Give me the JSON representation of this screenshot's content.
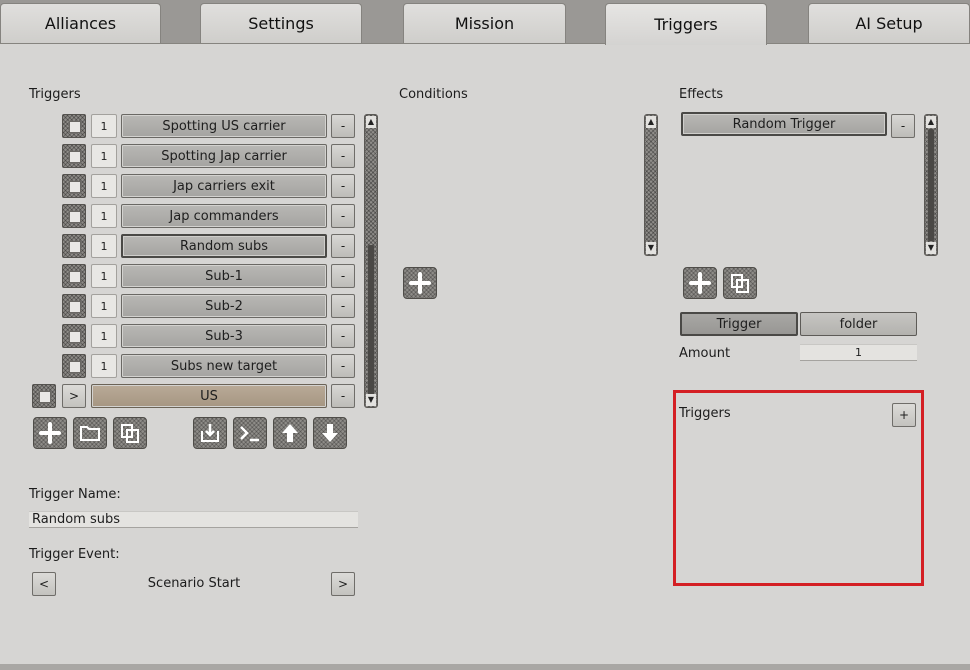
{
  "tabs": [
    {
      "label": "Alliances",
      "active": false
    },
    {
      "label": "Settings",
      "active": false
    },
    {
      "label": "Mission",
      "active": false
    },
    {
      "label": "Triggers",
      "active": true
    },
    {
      "label": "AI Setup",
      "active": false
    }
  ],
  "triggers_panel": {
    "heading": "Triggers",
    "items": [
      {
        "count": "1",
        "name": "Spotting US carrier",
        "selected": false
      },
      {
        "count": "1",
        "name": "Spotting Jap carrier",
        "selected": false
      },
      {
        "count": "1",
        "name": "Jap carriers exit",
        "selected": false
      },
      {
        "count": "1",
        "name": "Jap commanders",
        "selected": false
      },
      {
        "count": "1",
        "name": "Random subs",
        "selected": true
      },
      {
        "count": "1",
        "name": "Sub-1",
        "selected": false
      },
      {
        "count": "1",
        "name": "Sub-2",
        "selected": false
      },
      {
        "count": "1",
        "name": "Sub-3",
        "selected": false
      },
      {
        "count": "1",
        "name": "Subs new target",
        "selected": false
      }
    ],
    "folder_row": {
      "expand_label": ">",
      "name": "US"
    },
    "remove_label": "-",
    "trigger_name_label": "Trigger Name:",
    "trigger_name_value": "Random subs",
    "trigger_event_label": "Trigger Event:",
    "trigger_event_value": "Scenario Start",
    "prev_label": "<",
    "next_label": ">"
  },
  "conditions_panel": {
    "heading": "Conditions"
  },
  "effects_panel": {
    "heading": "Effects",
    "items": [
      {
        "name": "Random Trigger"
      }
    ],
    "remove_label": "-",
    "mode_options": [
      "Trigger",
      "folder"
    ],
    "mode_selected": "Trigger",
    "amount_label": "Amount",
    "amount_value": "1",
    "sub_triggers_heading": "Triggers",
    "sub_add_label": "+"
  },
  "icons": [
    "plus-icon",
    "folder-icon",
    "copy-icon",
    "import-icon",
    "console-icon",
    "arrow-up-icon",
    "arrow-down-icon",
    "checkbox-icon"
  ],
  "colors": {
    "highlight": "#d41f24",
    "folder_row": "#b9aa97",
    "panel_bg": "#d6d5d3"
  }
}
